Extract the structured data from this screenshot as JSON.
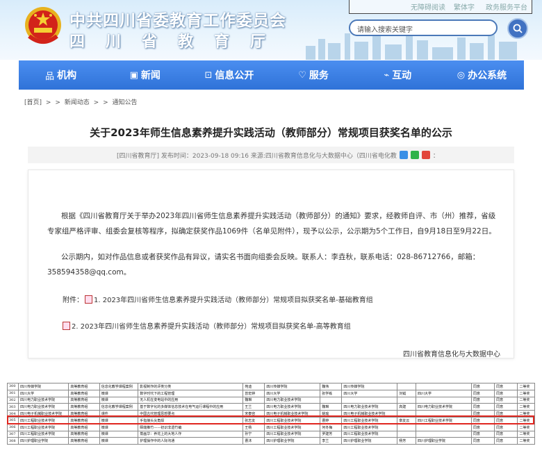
{
  "header": {
    "site_name": "中共四川省委教育工作委员会",
    "site_name_2": "四川省教育厅",
    "top_links": [
      "无障碍阅读",
      "繁体字",
      "政务服务平台"
    ],
    "search_placeholder": "请输入搜索关键字"
  },
  "nav": [
    {
      "icon": "org-icon",
      "glyph": "品",
      "label": "机构"
    },
    {
      "icon": "news-icon",
      "glyph": "▣",
      "label": "新闻"
    },
    {
      "icon": "info-icon",
      "glyph": "⊡",
      "label": "信息公开"
    },
    {
      "icon": "service-icon",
      "glyph": "♡",
      "label": "服务"
    },
    {
      "icon": "interact-icon",
      "glyph": "⌁",
      "label": "互动"
    },
    {
      "icon": "office-icon",
      "glyph": "◎",
      "label": "办公系统"
    }
  ],
  "breadcrumb": [
    "[首页]",
    ">",
    ">",
    "新闻动态",
    ">",
    ">",
    "通知公告"
  ],
  "article": {
    "title": "关于2023年师生信息素养提升实践活动（教师部分）常规项目获奖名单的公示",
    "meta": "[四川省教育厅]  发布时间：2023-09-18 09:16  来源:四川省教育信息化与大数据中心（四川省电化教",
    "meta_tail": "：",
    "para1": "根据《四川省教育厅关于举办2023年四川省师生信息素养提升实践活动（教师部分）的通知》要求，经教师自评、市（州）推荐，省级专家组严格评审、组委会复核等程序，拟确定获奖作品1069件（名单见附件），现予以公示，公示期为5个工作日，自9月18日至9月22日。",
    "para2": "公示期内，如对作品信息或者获奖作品有异议，请实名书面向组委会反映。联系人：李垚秋，联系电话：028-86712766，邮箱：358594358@qq.com。",
    "attach_label": "附件：",
    "attach1": "1. 2023年四川省师生信息素养提升实践活动（教师部分）常规项目拟获奖名单-基础教育组",
    "attach2": "2. 2023年四川省师生信息素养提升实践活动（教师部分）常规项目拟获奖名单-高等教育组",
    "signoff": "四川省教育信息化与大数据中心"
  },
  "table": {
    "rows": [
      [
        "300",
        "四川传媒学院",
        "高等教育组",
        "信息化教学课程案例",
        "影视制作的评类分类",
        "苑迪",
        "四川传媒学院",
        "魏伟",
        "四川传媒学院",
        "",
        "",
        "同意",
        "同意",
        "二等奖"
      ],
      [
        "301",
        "四川大学",
        "高等教育组",
        "微课",
        "数字时代下的工程管理",
        "曾宏婷",
        "四川大学",
        "张学栋",
        "四川大学",
        "刘钺",
        "四川大学",
        "同意",
        "同意",
        "二等奖"
      ],
      [
        "302",
        "四川电力职业技术学院",
        "高等教育组",
        "微课",
        "无人机在变电站中的应用",
        "魏琳",
        "四川电力职业技术学院",
        "",
        "",
        "",
        "",
        "同意",
        "同意",
        "二等奖"
      ],
      [
        "303",
        "四川电力职业技术学院",
        "高等教育组",
        "信息化教学课程案例",
        "基于数字化的多媒体信息技术在电气运行课程中的应用",
        "王兰",
        "四川电力职业技术学院",
        "魏琳",
        "四川电力职业技术学院",
        "高建",
        "四川电力职业技术学院",
        "同意",
        "同意",
        "二等奖"
      ],
      [
        "304",
        "四川电子机械职业技术学院",
        "高等教育组",
        "课件",
        "中国古代管理思想要点",
        "宋泰容",
        "四川电子机械职业技术学院",
        "姚瑜",
        "四川电子机械职业技术学院",
        "",
        "",
        "同意",
        "同意",
        "二等奖"
      ],
      [
        "305",
        "四川工程职业技术学院",
        "高等教育组",
        "微课",
        "手指接头尖角焊",
        "张志友",
        "四川工程职业技术学院",
        "曹婷",
        "四川工程职业技术学院",
        "章友云",
        "四川工程职业技术学院",
        "同意",
        "同意",
        "二等奖"
      ],
      [
        "306",
        "四川工程职业技术学院",
        "高等教育组",
        "微课",
        "瞬端推竹——初识非遗竹编",
        "王杨",
        "四川工程职业技术学院",
        "何冬梅",
        "四川工程职业技术学院",
        "",
        "",
        "同意",
        "同意",
        "二等奖"
      ],
      [
        "307",
        "四川工程职业技术学院",
        "高等教育组",
        "微课",
        "蒸画华：养花上的大地人作",
        "孙宁",
        "四川工程职业技术学院",
        "罗建芳",
        "四川工程职业技术学院",
        "",
        "",
        "同意",
        "同意",
        "二等奖"
      ],
      [
        "308",
        "四川护理职业学院",
        "高等教育组",
        "微课",
        "护理操作中的人际沟通",
        "曹沐",
        "四川护理职业学院",
        "李兰",
        "四川护理职业学院",
        "杨芳",
        "四川护理职业学院",
        "同意",
        "同意",
        "二等奖"
      ]
    ]
  },
  "colors": {
    "nav": "#2f72d8",
    "highlight": "#e0261f",
    "accent": "#4172c2"
  }
}
